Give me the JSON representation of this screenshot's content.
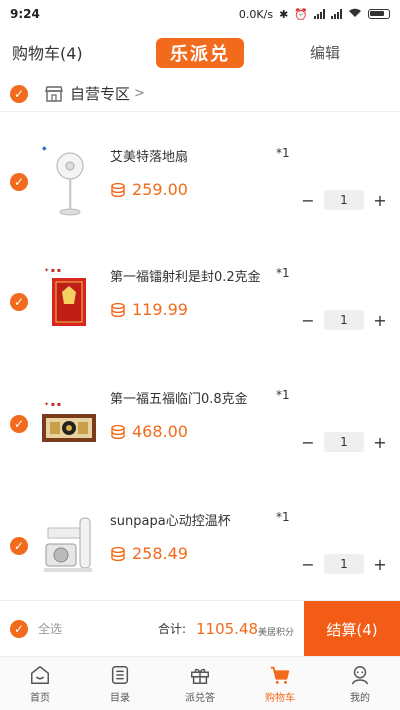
{
  "status_bar": {
    "time": "9:24",
    "network_speed": "0.0K/s"
  },
  "header": {
    "cart_title": "购物车(4)",
    "logo_text": "乐派兑",
    "edit_label": "编辑"
  },
  "store": {
    "name": "自营专区",
    "arrow": ">"
  },
  "items": [
    {
      "name": "艾美特落地扇",
      "qty_tag": "*1",
      "price": "259.00",
      "qty": "1"
    },
    {
      "name": "第一福镭射利是封0.2克金",
      "qty_tag": "*1",
      "price": "119.99",
      "qty": "1"
    },
    {
      "name": "第一福五福临门0.8克金",
      "qty_tag": "*1",
      "price": "468.00",
      "qty": "1"
    },
    {
      "name": "sunpapa心动控温杯",
      "qty_tag": "*1",
      "price": "258.49",
      "qty": "1"
    }
  ],
  "stepper": {
    "minus": "−",
    "plus": "+"
  },
  "checkout": {
    "select_all": "全选",
    "total_label": "合计:",
    "total_value": "1105.48",
    "total_unit": "美居积分",
    "button_label": "结算(4)"
  },
  "tabs": [
    {
      "label": "首页",
      "icon": "home-icon"
    },
    {
      "label": "目录",
      "icon": "catalog-icon"
    },
    {
      "label": "派兑答",
      "icon": "gift-icon"
    },
    {
      "label": "购物车",
      "icon": "cart-icon",
      "active": true
    },
    {
      "label": "我的",
      "icon": "user-icon"
    }
  ],
  "colors": {
    "accent": "#f26a1b",
    "checkout_button": "#f25c16"
  }
}
